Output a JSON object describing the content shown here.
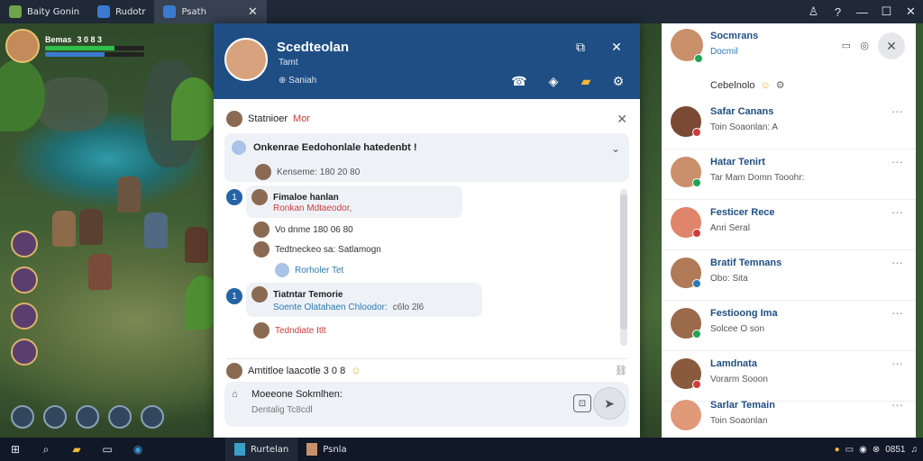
{
  "window": {
    "tabs": [
      {
        "label": "Baity Gonin"
      },
      {
        "label": "Rudotr"
      },
      {
        "label": "Psath"
      }
    ],
    "controls": {
      "minimize": "—",
      "maximize": "☐",
      "close": "✕"
    }
  },
  "game": {
    "player_name": "Bemas",
    "player_level": "3 0 8 3"
  },
  "chat": {
    "header": {
      "title": "Scedteolan",
      "subtitle": "Tamt",
      "status": "Saniah"
    },
    "subheader": {
      "label": "Statnioer",
      "highlight": "Mor"
    },
    "pinned": {
      "title": "Onkenrae Eedohonlale hatedenbt !",
      "meta": "Kenseme: 180 20 80"
    },
    "messages": [
      {
        "num": "1",
        "name": "Fimaloe hanlan",
        "text": "Ronkan Mdtaeodor,",
        "time": ""
      },
      {
        "name": "",
        "text": "Vo dnme 180 06 80"
      },
      {
        "name": "",
        "text": "Tedtneckeo sa: Satlamogn"
      },
      {
        "name": "",
        "text": "Rorholer Tet"
      },
      {
        "num": "1",
        "name": "Tiatntar Temorie",
        "text": "Soente Olatahaen Chloodor:",
        "extra": "c6lo 2l6"
      },
      {
        "name": "",
        "text": "Tedndiate Itlt"
      }
    ],
    "reply_label": "Amtitloe laacotle 3 0 8",
    "composer": {
      "line1": "Moeeone",
      "line1b": "Sokmlhen:",
      "placeholder": "Dentalig Tc8cdl"
    }
  },
  "panel": {
    "title": "Socmrans",
    "subtitle": "Docmil",
    "filter": "Cebelnolo",
    "contacts": [
      {
        "name": "Safar Canans",
        "line": "Toin",
        "line2": "Soaonlan: A"
      },
      {
        "name": "Hatar Tenirt",
        "line": "Tar Mam Domn",
        "line2": "Tooohr:"
      },
      {
        "name": "Festicer Rece",
        "line": "Anri",
        "line2": "Seral"
      },
      {
        "name": "Bratif Temnans",
        "line": "Obo:",
        "line2": "Sita"
      },
      {
        "name": "Festioong Ima",
        "line": "Solcee",
        "line2": "O son"
      },
      {
        "name": "Lamdnata",
        "line": "Vorarm",
        "line2": "Sooon"
      },
      {
        "name": "Sarlar Temain",
        "line": "Toin",
        "line2": "Soaonlan"
      }
    ]
  },
  "taskbar": {
    "apps": [
      {
        "label": "Rurtelan"
      },
      {
        "label": "Psnla"
      }
    ],
    "clock": "0851"
  },
  "colors": {
    "header_blue": "#1f4e85",
    "accent": "#2563a6",
    "online": "#22a455"
  }
}
